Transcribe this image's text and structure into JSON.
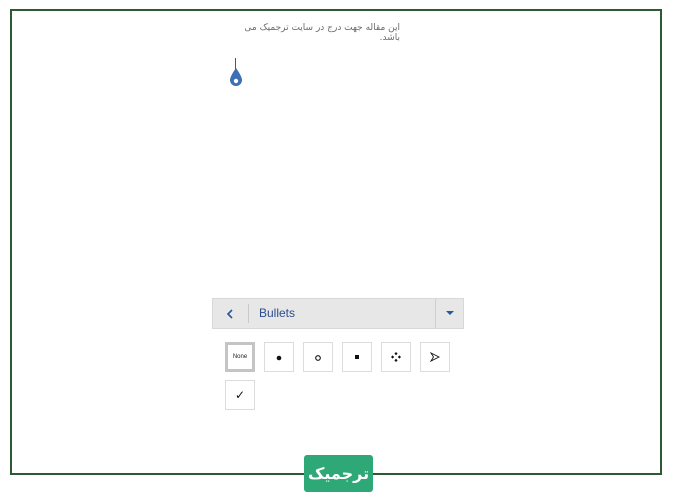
{
  "document": {
    "text": "این مقاله جهت درج در سایت ترجمیک می باشد."
  },
  "toolbar": {
    "back_icon": "chevron-left-icon",
    "title": "Bullets",
    "dropdown_icon": "caret-down-icon"
  },
  "bullets": [
    {
      "name": "none",
      "label": "None",
      "selected": true
    },
    {
      "name": "filled-circle",
      "icon": "filled-circle-icon",
      "selected": false
    },
    {
      "name": "hollow-circle",
      "icon": "hollow-circle-icon",
      "selected": false
    },
    {
      "name": "filled-square",
      "icon": "filled-square-icon",
      "selected": false
    },
    {
      "name": "diamond-cluster",
      "icon": "four-diamond-icon",
      "selected": false
    },
    {
      "name": "arrowhead",
      "icon": "arrowhead-icon",
      "selected": false
    },
    {
      "name": "checkmark",
      "glyph": "✓",
      "icon": "checkmark-icon",
      "selected": false
    }
  ],
  "logo": {
    "text": "ترجمیک"
  },
  "colors": {
    "frame": "#2e5a33",
    "accent": "#2b5797",
    "logo_bg": "#2fa877"
  }
}
